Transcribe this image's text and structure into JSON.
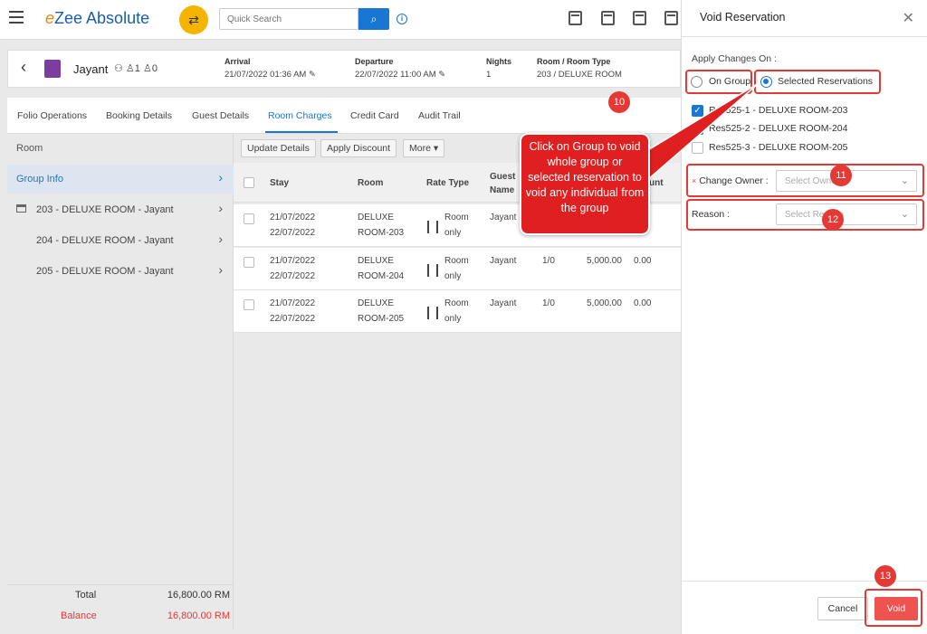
{
  "topbar": {
    "logo_text": "Zee Absolute",
    "logo_e": "e",
    "search_placeholder": "Quick Search"
  },
  "guest": {
    "name": "Jayant",
    "adults": "1",
    "children": "0",
    "arrival_label": "Arrival",
    "arrival_value": "21/07/2022 01:36 AM",
    "departure_label": "Departure",
    "departure_value": "22/07/2022 11:00 AM",
    "nights_label": "Nights",
    "nights_value": "1",
    "room_label": "Room / Room Type",
    "room_value": "203 / DELUXE ROOM"
  },
  "tabs": [
    "Folio Operations",
    "Booking Details",
    "Guest Details",
    "Room Charges",
    "Credit Card",
    "Audit Trail"
  ],
  "active_tab": "Room Charges",
  "room_panel": {
    "header": "Room",
    "items": [
      {
        "label": "Group Info",
        "selected": true
      },
      {
        "label": "203 - DELUXE ROOM - Jayant",
        "selected": false
      },
      {
        "label": "204 - DELUXE ROOM - Jayant",
        "selected": false
      },
      {
        "label": "205 - DELUXE ROOM - Jayant",
        "selected": false
      }
    ],
    "total_label": "Total",
    "total_value": "16,800.00 RM",
    "balance_label": "Balance",
    "balance_value": "16,800.00 RM"
  },
  "toolbar": {
    "update_label": "Update Details",
    "discount_label": "Apply Discount",
    "more_label": "More"
  },
  "grid": {
    "headers": {
      "stay": "Stay",
      "room": "Room",
      "rate_type": "Rate Type",
      "guest_name_1": "Guest",
      "guest_name_2": "Name",
      "cut_col": "unt"
    },
    "rows": [
      {
        "stay_from": "21/07/2022",
        "stay_to": "22/07/2022",
        "room_1": "DELUXE",
        "room_2": "ROOM-203",
        "rate_1": "Room",
        "rate_2": "only",
        "guest": "Jayant",
        "pax": "",
        "amount": "",
        "disc": ""
      },
      {
        "stay_from": "21/07/2022",
        "stay_to": "22/07/2022",
        "room_1": "DELUXE",
        "room_2": "ROOM-204",
        "rate_1": "Room",
        "rate_2": "only",
        "guest": "Jayant",
        "pax": "1/0",
        "amount": "5,000.00",
        "disc": "0.00"
      },
      {
        "stay_from": "21/07/2022",
        "stay_to": "22/07/2022",
        "room_1": "DELUXE",
        "room_2": "ROOM-205",
        "rate_1": "Room",
        "rate_2": "only",
        "guest": "Jayant",
        "pax": "1/0",
        "amount": "5,000.00",
        "disc": "0.00"
      }
    ]
  },
  "drawer": {
    "title": "Void Reservation",
    "apply_label": "Apply Changes On :",
    "on_group_label": "On Group",
    "selected_res_label": "Selected Reservations",
    "selected_option": "Selected Reservations",
    "reservations": [
      {
        "label": "Res525-1 - DELUXE ROOM-203",
        "checked": true
      },
      {
        "label": "Res525-2 - DELUXE ROOM-204",
        "checked": true
      },
      {
        "label": "Res525-3 - DELUXE ROOM-205",
        "checked": false
      }
    ],
    "change_owner_required": "×",
    "change_owner_label": "Change Owner :",
    "change_owner_placeholder": "Select Owner",
    "reason_label": "Reason :",
    "reason_placeholder": "Select Reason",
    "cancel_label": "Cancel",
    "void_label": "Void"
  },
  "annotations": {
    "callout_text": "Click on Group to void whole group or selected reservation to void any individual from the group",
    "step_10": "10",
    "step_11": "11",
    "step_12": "12",
    "step_13": "13",
    "color": "#e53935"
  }
}
